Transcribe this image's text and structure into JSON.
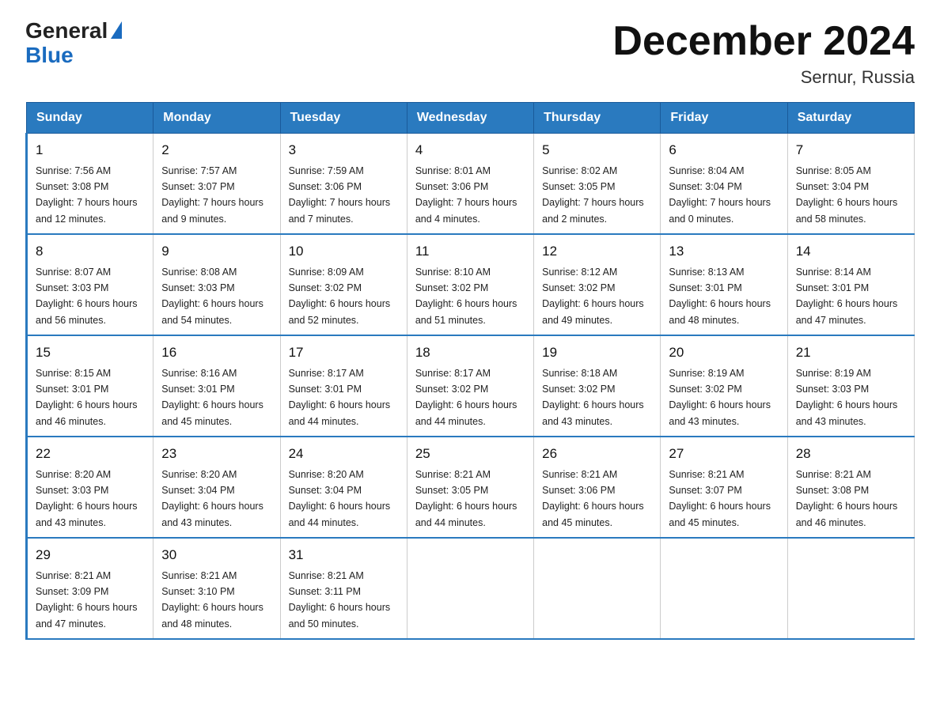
{
  "logo": {
    "general": "General",
    "blue": "Blue"
  },
  "title": "December 2024",
  "subtitle": "Sernur, Russia",
  "days_of_week": [
    "Sunday",
    "Monday",
    "Tuesday",
    "Wednesday",
    "Thursday",
    "Friday",
    "Saturday"
  ],
  "weeks": [
    [
      {
        "day": "1",
        "sunrise": "7:56 AM",
        "sunset": "3:08 PM",
        "daylight": "7 hours and 12 minutes."
      },
      {
        "day": "2",
        "sunrise": "7:57 AM",
        "sunset": "3:07 PM",
        "daylight": "7 hours and 9 minutes."
      },
      {
        "day": "3",
        "sunrise": "7:59 AM",
        "sunset": "3:06 PM",
        "daylight": "7 hours and 7 minutes."
      },
      {
        "day": "4",
        "sunrise": "8:01 AM",
        "sunset": "3:06 PM",
        "daylight": "7 hours and 4 minutes."
      },
      {
        "day": "5",
        "sunrise": "8:02 AM",
        "sunset": "3:05 PM",
        "daylight": "7 hours and 2 minutes."
      },
      {
        "day": "6",
        "sunrise": "8:04 AM",
        "sunset": "3:04 PM",
        "daylight": "7 hours and 0 minutes."
      },
      {
        "day": "7",
        "sunrise": "8:05 AM",
        "sunset": "3:04 PM",
        "daylight": "6 hours and 58 minutes."
      }
    ],
    [
      {
        "day": "8",
        "sunrise": "8:07 AM",
        "sunset": "3:03 PM",
        "daylight": "6 hours and 56 minutes."
      },
      {
        "day": "9",
        "sunrise": "8:08 AM",
        "sunset": "3:03 PM",
        "daylight": "6 hours and 54 minutes."
      },
      {
        "day": "10",
        "sunrise": "8:09 AM",
        "sunset": "3:02 PM",
        "daylight": "6 hours and 52 minutes."
      },
      {
        "day": "11",
        "sunrise": "8:10 AM",
        "sunset": "3:02 PM",
        "daylight": "6 hours and 51 minutes."
      },
      {
        "day": "12",
        "sunrise": "8:12 AM",
        "sunset": "3:02 PM",
        "daylight": "6 hours and 49 minutes."
      },
      {
        "day": "13",
        "sunrise": "8:13 AM",
        "sunset": "3:01 PM",
        "daylight": "6 hours and 48 minutes."
      },
      {
        "day": "14",
        "sunrise": "8:14 AM",
        "sunset": "3:01 PM",
        "daylight": "6 hours and 47 minutes."
      }
    ],
    [
      {
        "day": "15",
        "sunrise": "8:15 AM",
        "sunset": "3:01 PM",
        "daylight": "6 hours and 46 minutes."
      },
      {
        "day": "16",
        "sunrise": "8:16 AM",
        "sunset": "3:01 PM",
        "daylight": "6 hours and 45 minutes."
      },
      {
        "day": "17",
        "sunrise": "8:17 AM",
        "sunset": "3:01 PM",
        "daylight": "6 hours and 44 minutes."
      },
      {
        "day": "18",
        "sunrise": "8:17 AM",
        "sunset": "3:02 PM",
        "daylight": "6 hours and 44 minutes."
      },
      {
        "day": "19",
        "sunrise": "8:18 AM",
        "sunset": "3:02 PM",
        "daylight": "6 hours and 43 minutes."
      },
      {
        "day": "20",
        "sunrise": "8:19 AM",
        "sunset": "3:02 PM",
        "daylight": "6 hours and 43 minutes."
      },
      {
        "day": "21",
        "sunrise": "8:19 AM",
        "sunset": "3:03 PM",
        "daylight": "6 hours and 43 minutes."
      }
    ],
    [
      {
        "day": "22",
        "sunrise": "8:20 AM",
        "sunset": "3:03 PM",
        "daylight": "6 hours and 43 minutes."
      },
      {
        "day": "23",
        "sunrise": "8:20 AM",
        "sunset": "3:04 PM",
        "daylight": "6 hours and 43 minutes."
      },
      {
        "day": "24",
        "sunrise": "8:20 AM",
        "sunset": "3:04 PM",
        "daylight": "6 hours and 44 minutes."
      },
      {
        "day": "25",
        "sunrise": "8:21 AM",
        "sunset": "3:05 PM",
        "daylight": "6 hours and 44 minutes."
      },
      {
        "day": "26",
        "sunrise": "8:21 AM",
        "sunset": "3:06 PM",
        "daylight": "6 hours and 45 minutes."
      },
      {
        "day": "27",
        "sunrise": "8:21 AM",
        "sunset": "3:07 PM",
        "daylight": "6 hours and 45 minutes."
      },
      {
        "day": "28",
        "sunrise": "8:21 AM",
        "sunset": "3:08 PM",
        "daylight": "6 hours and 46 minutes."
      }
    ],
    [
      {
        "day": "29",
        "sunrise": "8:21 AM",
        "sunset": "3:09 PM",
        "daylight": "6 hours and 47 minutes."
      },
      {
        "day": "30",
        "sunrise": "8:21 AM",
        "sunset": "3:10 PM",
        "daylight": "6 hours and 48 minutes."
      },
      {
        "day": "31",
        "sunrise": "8:21 AM",
        "sunset": "3:11 PM",
        "daylight": "6 hours and 50 minutes."
      },
      null,
      null,
      null,
      null
    ]
  ],
  "labels": {
    "sunrise": "Sunrise:",
    "sunset": "Sunset:",
    "daylight": "Daylight:"
  }
}
